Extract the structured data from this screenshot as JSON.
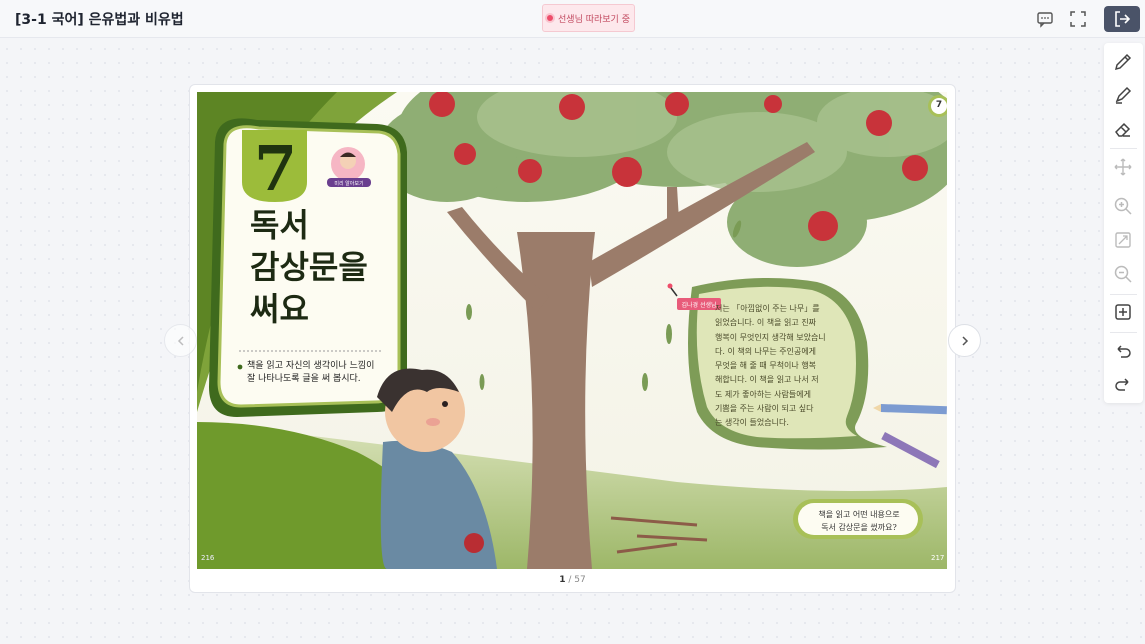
{
  "header": {
    "title": "[3-1 국어] 은유법과 비유법",
    "follow_status": "선생님 따라보기 중"
  },
  "toolbar_icons": [
    "chat-icon",
    "fullscreen-icon",
    "exit-icon"
  ],
  "tools": [
    "pen-icon",
    "highlighter-icon",
    "eraser-icon",
    "move-icon",
    "zoom-in-icon",
    "fit-icon",
    "zoom-out-icon",
    "add-page-icon",
    "undo-icon",
    "redo-icon"
  ],
  "book": {
    "unit_number": "7",
    "unit_badge": "7",
    "title_line1": "독서",
    "title_line2": "감상문을",
    "title_line3": "써요",
    "objective_line1": "책을 읽고 자신의 생각이나 느낌이",
    "objective_line2": "잘 나타나도록 글을 써 봅시다.",
    "preview_label": "미리 알아보기",
    "cursor_label": "김나경 선생님",
    "leaf_text": [
      "저는 「아낌없이 주는 나무」를",
      "읽었습니다. 이 책을 읽고 진짜",
      "행복이 무엇인지 생각해 보았습니",
      "다. 이 책의 나무는 주인공에게",
      "무엇을 해 줄 때 무척이나 행복",
      "해합니다. 이 책을 읽고 나서 저",
      "도 제가 좋아하는 사람들에게",
      "기쁨을 주는 사람이 되고 싶다",
      "는 생각이 들었습니다."
    ],
    "question_line1": "책을 읽고 어떤 내용으로",
    "question_line2": "독서 감상문을 썼까요?",
    "page_left": "216",
    "page_right": "217"
  },
  "pager": {
    "current": "1",
    "total": "/ 57"
  }
}
